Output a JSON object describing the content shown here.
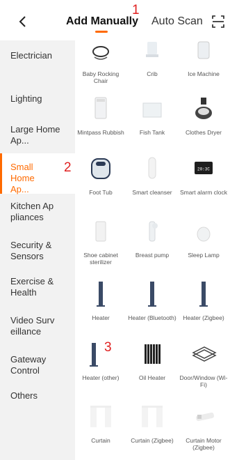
{
  "header": {
    "back_label": "<",
    "tab_manual": "Add Manually",
    "tab_auto": "Auto Scan",
    "annotation_1": "1"
  },
  "sidebar": {
    "items": [
      {
        "label": "Electrician"
      },
      {
        "label": "Lighting"
      },
      {
        "label": "Large Home Ap..."
      },
      {
        "label": "Small Home Ap...",
        "active": true
      },
      {
        "label": "Kitchen Ap pliances"
      },
      {
        "label": "Security & Sensors"
      },
      {
        "label": "Exercise & Health"
      },
      {
        "label": "Video Surv eillance"
      },
      {
        "label": "Gateway Control"
      },
      {
        "label": "Others"
      }
    ],
    "annotation_2": "2"
  },
  "devices": [
    {
      "name": "Baby Rocking Chair",
      "icon": "rocking-chair-icon"
    },
    {
      "name": "Crib",
      "icon": "crib-icon"
    },
    {
      "name": "Ice Machine",
      "icon": "ice-machine-icon"
    },
    {
      "name": "Mintpass Rubbish",
      "icon": "rubbish-bin-icon"
    },
    {
      "name": "Fish Tank",
      "icon": "fish-tank-icon"
    },
    {
      "name": "Clothes Dryer",
      "icon": "clothes-dryer-icon"
    },
    {
      "name": "Foot Tub",
      "icon": "foot-tub-icon"
    },
    {
      "name": "Smart cleanser",
      "icon": "cleanser-icon"
    },
    {
      "name": "Smart alarm clock",
      "icon": "alarm-clock-icon",
      "display": "20:3C"
    },
    {
      "name": "Shoe cabinet sterilizer",
      "icon": "shoe-cabinet-icon"
    },
    {
      "name": "Breast pump",
      "icon": "breast-pump-icon"
    },
    {
      "name": "Sleep Lamp",
      "icon": "sleep-lamp-icon"
    },
    {
      "name": "Heater",
      "icon": "heater-icon"
    },
    {
      "name": "Heater (Bluetooth)",
      "icon": "heater-icon"
    },
    {
      "name": "Heater (Zigbee)",
      "icon": "heater-icon"
    },
    {
      "name": "Heater (other)",
      "icon": "heater-icon"
    },
    {
      "name": "Oil Heater",
      "icon": "oil-heater-icon"
    },
    {
      "name": "Door/Window (Wi-Fi)",
      "icon": "door-window-sensor-icon"
    },
    {
      "name": "Curtain",
      "icon": "curtain-icon"
    },
    {
      "name": "Curtain (Zigbee)",
      "icon": "curtain-icon"
    },
    {
      "name": "Curtain Motor (Zigbee)",
      "icon": "curtain-motor-icon"
    }
  ],
  "annotation_3": "3",
  "colors": {
    "accent": "#ff6a00",
    "annotation": "#e02020",
    "sidebar_bg": "#f2f2f2"
  }
}
